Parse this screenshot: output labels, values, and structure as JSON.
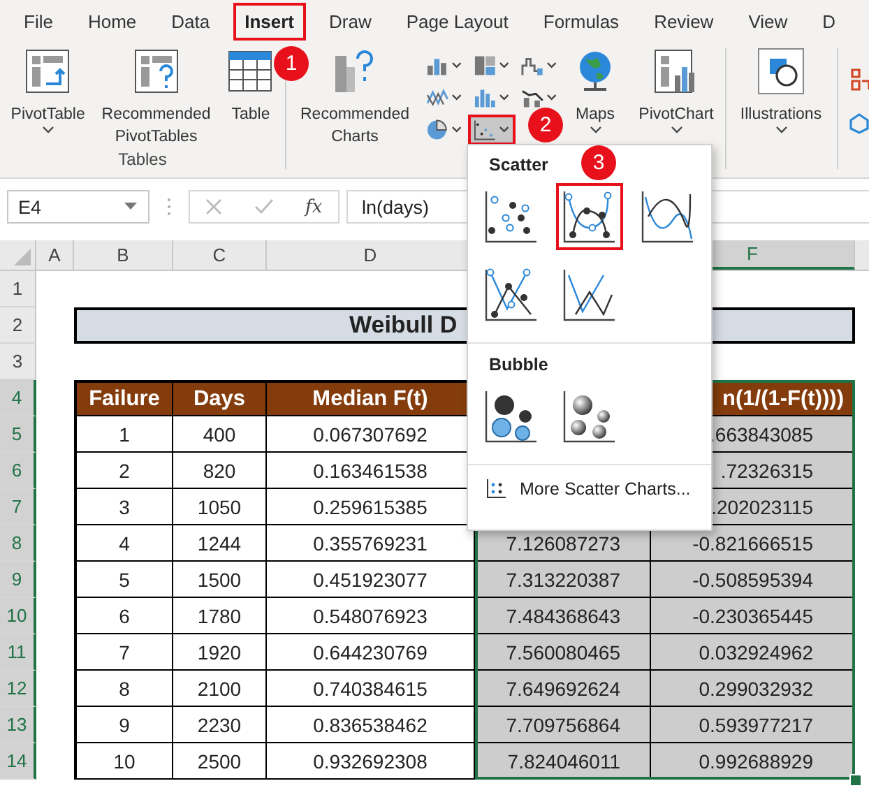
{
  "ribbon_tabs": [
    {
      "label": "File",
      "selected": false
    },
    {
      "label": "Home",
      "selected": false
    },
    {
      "label": "Data",
      "selected": false
    },
    {
      "label": "Insert",
      "selected": true
    },
    {
      "label": "Draw",
      "selected": false
    },
    {
      "label": "Page Layout",
      "selected": false
    },
    {
      "label": "Formulas",
      "selected": false
    },
    {
      "label": "Review",
      "selected": false
    },
    {
      "label": "View",
      "selected": false
    },
    {
      "label": "D",
      "selected": false
    }
  ],
  "ribbon": {
    "groups": [
      {
        "label": "Tables",
        "buttons": [
          {
            "label": "PivotTable",
            "kind": "pivot-table",
            "dropdown": true
          },
          {
            "label": "Recommended PivotTables",
            "kind": "recommended-pivot",
            "dropdown": false
          },
          {
            "label": "Table",
            "kind": "table",
            "dropdown": false
          }
        ]
      },
      {
        "buttons": [
          {
            "label": "Recommended Charts",
            "kind": "recommended-charts",
            "dropdown": false
          },
          {
            "kind": "chart-gallery"
          },
          {
            "label": "Maps",
            "kind": "maps",
            "dropdown": true
          },
          {
            "label": "PivotChart",
            "kind": "pivot-chart",
            "dropdown": true
          }
        ]
      },
      {
        "buttons": [
          {
            "label": "Illustrations",
            "kind": "illustrations",
            "dropdown": true
          }
        ]
      },
      {
        "buttons": [
          {
            "kind": "cut-icons"
          }
        ]
      }
    ]
  },
  "chart_gallery": [
    {
      "kind": "column",
      "highlighted": false
    },
    {
      "kind": "hierarchy",
      "highlighted": false
    },
    {
      "kind": "waterfall",
      "highlighted": false
    },
    {
      "kind": "line",
      "highlighted": false
    },
    {
      "kind": "statistic",
      "highlighted": false
    },
    {
      "kind": "combo",
      "highlighted": false
    },
    {
      "kind": "pie",
      "highlighted": false
    },
    {
      "kind": "scatter",
      "highlighted": true
    }
  ],
  "formula_bar": {
    "name_box": "E4",
    "function_label": "fx",
    "formula": "ln(days)"
  },
  "columns": [
    {
      "label": "A",
      "selected": false
    },
    {
      "label": "B",
      "selected": false
    },
    {
      "label": "C",
      "selected": false
    },
    {
      "label": "D",
      "selected": false
    },
    {
      "label": "F",
      "selected": true
    }
  ],
  "row_headers": [
    {
      "label": "1",
      "selected": false
    },
    {
      "label": "2",
      "selected": false
    },
    {
      "label": "3",
      "selected": false
    },
    {
      "label": "4",
      "selected": true
    },
    {
      "label": "5",
      "selected": true
    },
    {
      "label": "6",
      "selected": true
    },
    {
      "label": "7",
      "selected": true
    },
    {
      "label": "8",
      "selected": true
    },
    {
      "label": "9",
      "selected": true
    },
    {
      "label": "10",
      "selected": true
    },
    {
      "label": "11",
      "selected": true
    },
    {
      "label": "12",
      "selected": true
    },
    {
      "label": "13",
      "selected": true
    },
    {
      "label": "14",
      "selected": true
    }
  ],
  "table": {
    "title": "Weibull D",
    "headers": {
      "failure": "Failure",
      "days": "Days",
      "median": "Median F(t)",
      "column_f": "n(1/(1-F(t))))"
    },
    "rows": [
      {
        "failure": "1",
        "days": "400",
        "median": "0.067307692",
        "column_f": ".663843085"
      },
      {
        "failure": "2",
        "days": "820",
        "median": "0.163461538",
        "column_f": ".72326315"
      },
      {
        "failure": "3",
        "days": "1050",
        "median": "0.259615385",
        "column_f": ".202023115"
      },
      {
        "failure": "4",
        "days": "1244",
        "median": "0.355769231",
        "column_e": "7.126087273",
        "column_f": "-0.821666515"
      },
      {
        "failure": "5",
        "days": "1500",
        "median": "0.451923077",
        "column_e": "7.313220387",
        "column_f": "-0.508595394"
      },
      {
        "failure": "6",
        "days": "1780",
        "median": "0.548076923",
        "column_e": "7.484368643",
        "column_f": "-0.230365445"
      },
      {
        "failure": "7",
        "days": "1920",
        "median": "0.644230769",
        "column_e": "7.560080465",
        "column_f": "0.032924962"
      },
      {
        "failure": "8",
        "days": "2100",
        "median": "0.740384615",
        "column_e": "7.649692624",
        "column_f": "0.299032932"
      },
      {
        "failure": "9",
        "days": "2230",
        "median": "0.836538462",
        "column_e": "7.709756864",
        "column_f": "0.593977217"
      },
      {
        "failure": "10",
        "days": "2500",
        "median": "0.932692308",
        "column_e": "7.824046011",
        "column_f": "0.992688929"
      }
    ]
  },
  "scatter_menu": {
    "sections": [
      {
        "title": "Scatter",
        "options": [
          {
            "kind": "markers",
            "selected": false
          },
          {
            "kind": "smooth-lines-markers",
            "selected": true
          },
          {
            "kind": "smooth-lines",
            "selected": false
          },
          {
            "kind": "straight-lines-markers",
            "selected": false
          },
          {
            "kind": "straight-lines",
            "selected": false
          }
        ]
      },
      {
        "title": "Bubble",
        "options": [
          {
            "kind": "bubble",
            "selected": false
          },
          {
            "kind": "bubble-3d",
            "selected": false
          }
        ]
      }
    ],
    "more_link": "More Scatter Charts..."
  },
  "callouts": [
    "1",
    "2",
    "3"
  ]
}
